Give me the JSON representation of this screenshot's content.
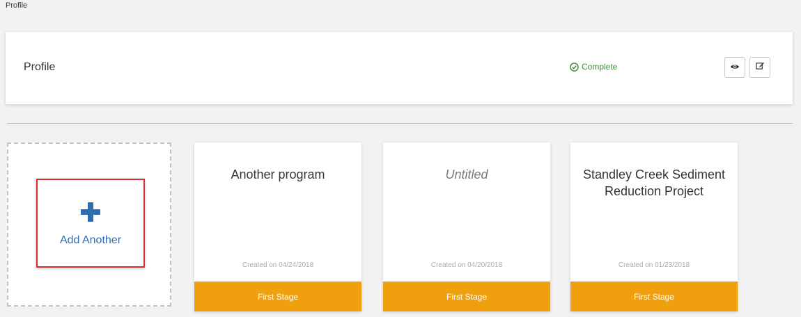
{
  "breadcrumb": "Profile",
  "profile": {
    "title": "Profile",
    "status": "Complete",
    "status_color": "#3c8d3c",
    "status_icon": "check-circle-icon",
    "actions": [
      {
        "name": "view",
        "icon": "eye-icon"
      },
      {
        "name": "edit",
        "icon": "edit-icon"
      }
    ]
  },
  "add_tile": {
    "label": "Add Another",
    "icon": "plus-icon",
    "accent": "#2f6db3",
    "highlight": "#d32f2f"
  },
  "programs": [
    {
      "title": "Another program",
      "untitled": false,
      "created": "Created on 04/24/2018",
      "stage": "First Stage"
    },
    {
      "title": "Untitled",
      "untitled": true,
      "created": "Created on 04/20/2018",
      "stage": "First Stage"
    },
    {
      "title": "Standley Creek Sediment Reduction Project",
      "untitled": false,
      "created": "Created on 01/23/2018",
      "stage": "First Stage"
    }
  ],
  "stage_color": "#f0a00e"
}
